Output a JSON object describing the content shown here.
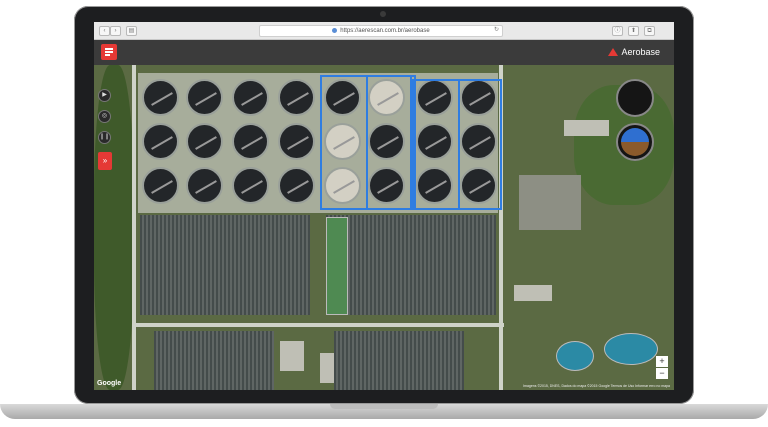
{
  "browser": {
    "url": "https://aerescan.com.br/aerobase",
    "nav_back": "‹",
    "nav_forward": "›",
    "sidebar_toggle": "▤",
    "reload": "↻",
    "share": "⬆",
    "tabs": "⧉",
    "info": "ⓘ"
  },
  "app": {
    "brand_name": "Aerobase",
    "accent_color": "#e53935"
  },
  "map": {
    "provider_label": "Google",
    "attribution": "Imagens ©2015, DNES, Dados do mapa ©2015 Google   Termos de Uso   Informar erro no mapa",
    "zoom_in": "+",
    "zoom_out": "−",
    "route_color": "#2f7de1"
  },
  "toolbar": {
    "play_icon": "▶",
    "layers_icon": "◎",
    "pause_icon": "❙❙",
    "collapse_icon": "»"
  }
}
